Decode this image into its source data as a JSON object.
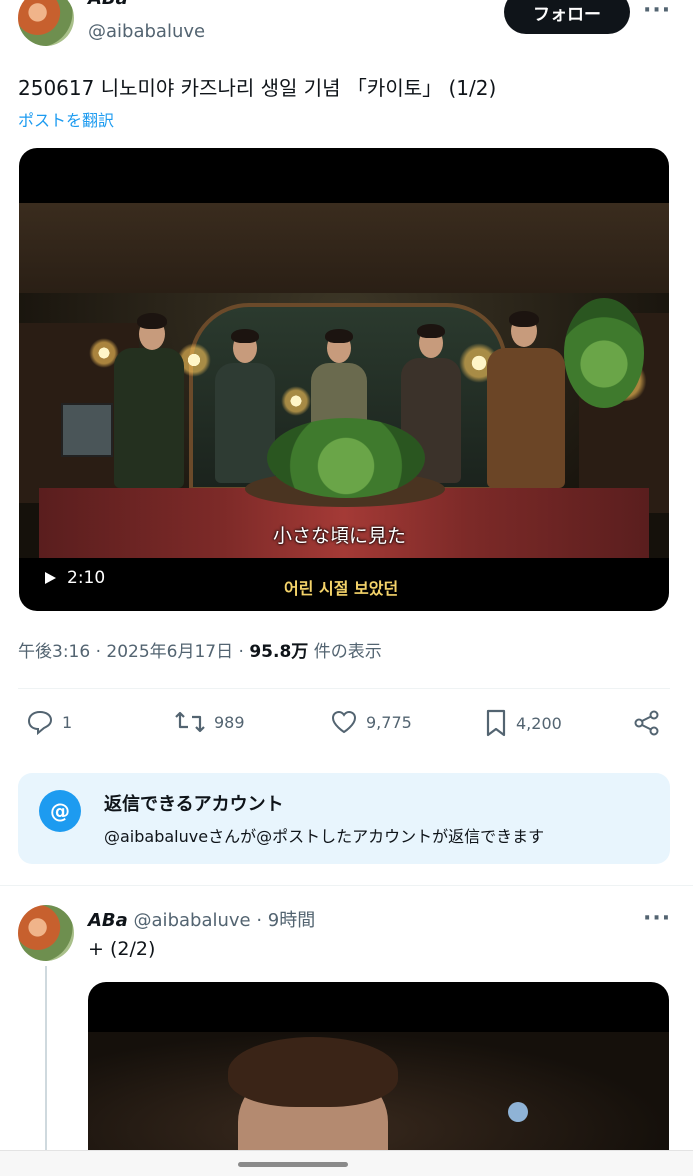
{
  "post": {
    "display_name": "ABa",
    "handle": "@aibabaluve",
    "follow_label": "フォロー",
    "more": "···",
    "text": "250617 니노미야 카즈나리 생일 기념 「카이토」 (1/2)",
    "translate_label": "ポストを翻訳",
    "video": {
      "subtitle_jp": "小さな頃に見た",
      "subtitle_ko": "어린 시절 보았던",
      "duration": "2:10"
    },
    "meta": {
      "time": "午後3:16",
      "sep1": " · ",
      "date": "2025年6月17日",
      "sep2": " · ",
      "views": "95.8万",
      "views_suffix": " 件の表示"
    },
    "actions": {
      "replies": "1",
      "reposts": "989",
      "likes": "9,775",
      "bookmarks": "4,200"
    },
    "reply_restriction": {
      "title": "返信できるアカウント",
      "body": "@aibabaluveさんが@ポストしたアカウントが返信できます"
    }
  },
  "reply_post": {
    "display_name": "ABa",
    "handle": "@aibabaluve",
    "time_sep": " · ",
    "time": "9時間",
    "more": "···",
    "text": "+ (2/2)"
  },
  "colors": {
    "accent": "#1d9bf0",
    "text": "#0f1419",
    "secondary": "#536471"
  }
}
